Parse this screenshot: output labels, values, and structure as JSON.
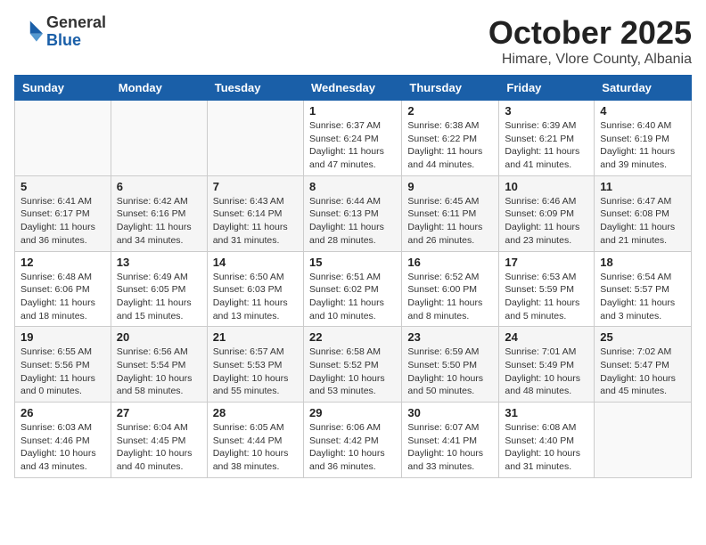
{
  "logo": {
    "general": "General",
    "blue": "Blue"
  },
  "title": "October 2025",
  "subtitle": "Himare, Vlore County, Albania",
  "weekdays": [
    "Sunday",
    "Monday",
    "Tuesday",
    "Wednesday",
    "Thursday",
    "Friday",
    "Saturday"
  ],
  "weeks": [
    [
      {
        "day": "",
        "info": ""
      },
      {
        "day": "",
        "info": ""
      },
      {
        "day": "",
        "info": ""
      },
      {
        "day": "1",
        "info": "Sunrise: 6:37 AM\nSunset: 6:24 PM\nDaylight: 11 hours and 47 minutes."
      },
      {
        "day": "2",
        "info": "Sunrise: 6:38 AM\nSunset: 6:22 PM\nDaylight: 11 hours and 44 minutes."
      },
      {
        "day": "3",
        "info": "Sunrise: 6:39 AM\nSunset: 6:21 PM\nDaylight: 11 hours and 41 minutes."
      },
      {
        "day": "4",
        "info": "Sunrise: 6:40 AM\nSunset: 6:19 PM\nDaylight: 11 hours and 39 minutes."
      }
    ],
    [
      {
        "day": "5",
        "info": "Sunrise: 6:41 AM\nSunset: 6:17 PM\nDaylight: 11 hours and 36 minutes."
      },
      {
        "day": "6",
        "info": "Sunrise: 6:42 AM\nSunset: 6:16 PM\nDaylight: 11 hours and 34 minutes."
      },
      {
        "day": "7",
        "info": "Sunrise: 6:43 AM\nSunset: 6:14 PM\nDaylight: 11 hours and 31 minutes."
      },
      {
        "day": "8",
        "info": "Sunrise: 6:44 AM\nSunset: 6:13 PM\nDaylight: 11 hours and 28 minutes."
      },
      {
        "day": "9",
        "info": "Sunrise: 6:45 AM\nSunset: 6:11 PM\nDaylight: 11 hours and 26 minutes."
      },
      {
        "day": "10",
        "info": "Sunrise: 6:46 AM\nSunset: 6:09 PM\nDaylight: 11 hours and 23 minutes."
      },
      {
        "day": "11",
        "info": "Sunrise: 6:47 AM\nSunset: 6:08 PM\nDaylight: 11 hours and 21 minutes."
      }
    ],
    [
      {
        "day": "12",
        "info": "Sunrise: 6:48 AM\nSunset: 6:06 PM\nDaylight: 11 hours and 18 minutes."
      },
      {
        "day": "13",
        "info": "Sunrise: 6:49 AM\nSunset: 6:05 PM\nDaylight: 11 hours and 15 minutes."
      },
      {
        "day": "14",
        "info": "Sunrise: 6:50 AM\nSunset: 6:03 PM\nDaylight: 11 hours and 13 minutes."
      },
      {
        "day": "15",
        "info": "Sunrise: 6:51 AM\nSunset: 6:02 PM\nDaylight: 11 hours and 10 minutes."
      },
      {
        "day": "16",
        "info": "Sunrise: 6:52 AM\nSunset: 6:00 PM\nDaylight: 11 hours and 8 minutes."
      },
      {
        "day": "17",
        "info": "Sunrise: 6:53 AM\nSunset: 5:59 PM\nDaylight: 11 hours and 5 minutes."
      },
      {
        "day": "18",
        "info": "Sunrise: 6:54 AM\nSunset: 5:57 PM\nDaylight: 11 hours and 3 minutes."
      }
    ],
    [
      {
        "day": "19",
        "info": "Sunrise: 6:55 AM\nSunset: 5:56 PM\nDaylight: 11 hours and 0 minutes."
      },
      {
        "day": "20",
        "info": "Sunrise: 6:56 AM\nSunset: 5:54 PM\nDaylight: 10 hours and 58 minutes."
      },
      {
        "day": "21",
        "info": "Sunrise: 6:57 AM\nSunset: 5:53 PM\nDaylight: 10 hours and 55 minutes."
      },
      {
        "day": "22",
        "info": "Sunrise: 6:58 AM\nSunset: 5:52 PM\nDaylight: 10 hours and 53 minutes."
      },
      {
        "day": "23",
        "info": "Sunrise: 6:59 AM\nSunset: 5:50 PM\nDaylight: 10 hours and 50 minutes."
      },
      {
        "day": "24",
        "info": "Sunrise: 7:01 AM\nSunset: 5:49 PM\nDaylight: 10 hours and 48 minutes."
      },
      {
        "day": "25",
        "info": "Sunrise: 7:02 AM\nSunset: 5:47 PM\nDaylight: 10 hours and 45 minutes."
      }
    ],
    [
      {
        "day": "26",
        "info": "Sunrise: 6:03 AM\nSunset: 4:46 PM\nDaylight: 10 hours and 43 minutes."
      },
      {
        "day": "27",
        "info": "Sunrise: 6:04 AM\nSunset: 4:45 PM\nDaylight: 10 hours and 40 minutes."
      },
      {
        "day": "28",
        "info": "Sunrise: 6:05 AM\nSunset: 4:44 PM\nDaylight: 10 hours and 38 minutes."
      },
      {
        "day": "29",
        "info": "Sunrise: 6:06 AM\nSunset: 4:42 PM\nDaylight: 10 hours and 36 minutes."
      },
      {
        "day": "30",
        "info": "Sunrise: 6:07 AM\nSunset: 4:41 PM\nDaylight: 10 hours and 33 minutes."
      },
      {
        "day": "31",
        "info": "Sunrise: 6:08 AM\nSunset: 4:40 PM\nDaylight: 10 hours and 31 minutes."
      },
      {
        "day": "",
        "info": ""
      }
    ]
  ]
}
